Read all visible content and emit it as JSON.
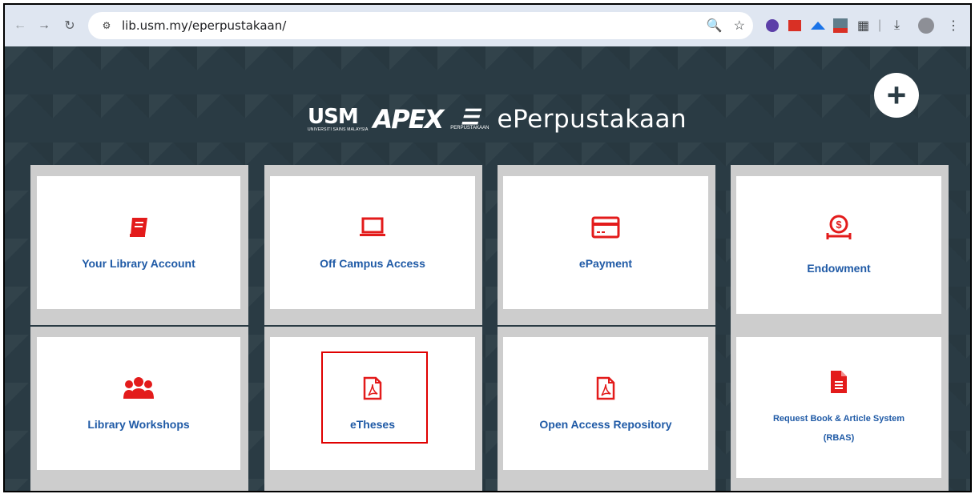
{
  "browser": {
    "url": "lib.usm.my/eperpustakaan/"
  },
  "header": {
    "usm_logo_text": "USM",
    "usm_logo_subtext": "UNIVERSITI SAINS MALAYSIA",
    "apex_logo_text": "APEX",
    "perpustakaan_logo_text": "PERPUSTAKAAN",
    "title": "ePerpustakaan",
    "add_button_symbol": "+"
  },
  "tiles": [
    {
      "label": "Your Library Account",
      "icon": "book-icon"
    },
    {
      "label": "Off Campus Access",
      "icon": "laptop-icon"
    },
    {
      "label": "ePayment",
      "icon": "credit-card-icon"
    },
    {
      "label": "Endowment",
      "icon": "money-hand-icon"
    },
    {
      "label": "Library Workshops",
      "icon": "users-icon"
    },
    {
      "label": "eTheses",
      "icon": "pdf-icon"
    },
    {
      "label": "Open Access Repository",
      "icon": "pdf-icon"
    },
    {
      "label_line1": "Request Book & Article System",
      "label_line2": "(RBAS)",
      "icon": "file-text-icon"
    }
  ],
  "colors": {
    "background": "#2a3b44",
    "icon_red": "#e31b1b",
    "label_blue": "#1f5aa6",
    "highlight_red": "#e00000"
  }
}
